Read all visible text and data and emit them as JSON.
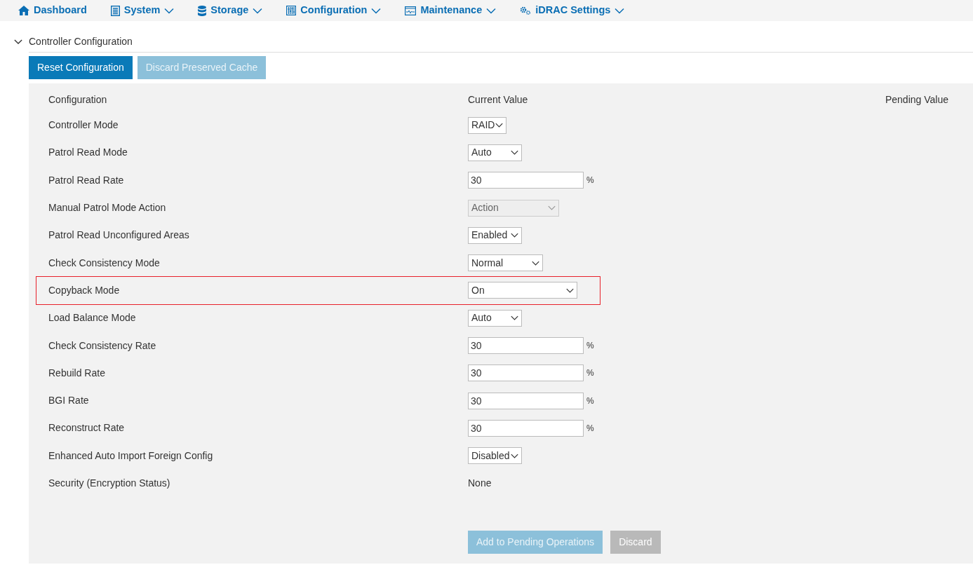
{
  "nav": [
    {
      "label": "Dashboard",
      "dropdown": false
    },
    {
      "label": "System",
      "dropdown": true
    },
    {
      "label": "Storage",
      "dropdown": true
    },
    {
      "label": "Configuration",
      "dropdown": true
    },
    {
      "label": "Maintenance",
      "dropdown": true
    },
    {
      "label": "iDRAC Settings",
      "dropdown": true
    }
  ],
  "section": {
    "title": "Controller Configuration",
    "expanded": true
  },
  "actions": [
    {
      "label": "Reset Configuration",
      "disabled": false
    },
    {
      "label": "Discard Preserved Cache",
      "disabled": true
    }
  ],
  "table": {
    "columns": [
      "Configuration",
      "Current Value",
      "Pending Value"
    ],
    "rows": [
      {
        "label": "Controller Mode",
        "kind": "select",
        "value": "RAID",
        "disabled": false,
        "highlighted": false
      },
      {
        "label": "Patrol Read Mode",
        "kind": "select",
        "value": "Auto",
        "disabled": false,
        "highlighted": false
      },
      {
        "label": "Patrol Read Rate",
        "kind": "number",
        "value": "30",
        "unit": "%",
        "highlighted": false
      },
      {
        "label": "Manual Patrol Mode Action",
        "kind": "select",
        "value": "Action",
        "disabled": true,
        "highlighted": false
      },
      {
        "label": "Patrol Read Unconfigured Areas",
        "kind": "select",
        "value": "Enabled",
        "disabled": false,
        "highlighted": false
      },
      {
        "label": "Check Consistency Mode",
        "kind": "select",
        "value": "Normal",
        "disabled": false,
        "highlighted": false
      },
      {
        "label": "Copyback Mode",
        "kind": "select",
        "value": "On",
        "disabled": false,
        "highlighted": true
      },
      {
        "label": "Load Balance Mode",
        "kind": "select",
        "value": "Auto",
        "disabled": false,
        "highlighted": false
      },
      {
        "label": "Check Consistency Rate",
        "kind": "number",
        "value": "30",
        "unit": "%",
        "highlighted": false
      },
      {
        "label": "Rebuild Rate",
        "kind": "number",
        "value": "30",
        "unit": "%",
        "highlighted": false
      },
      {
        "label": "BGI Rate",
        "kind": "number",
        "value": "30",
        "unit": "%",
        "highlighted": false
      },
      {
        "label": "Reconstruct Rate",
        "kind": "number",
        "value": "30",
        "unit": "%",
        "highlighted": false
      },
      {
        "label": "Enhanced Auto Import Foreign Config",
        "kind": "select",
        "value": "Disabled",
        "disabled": false,
        "highlighted": false
      },
      {
        "label": "Security (Encryption Status)",
        "kind": "text",
        "value": "None",
        "highlighted": false
      }
    ]
  },
  "footer_buttons": [
    {
      "label": "Add to Pending Operations",
      "disabled": true
    },
    {
      "label": "Discard",
      "disabled": true
    }
  ]
}
